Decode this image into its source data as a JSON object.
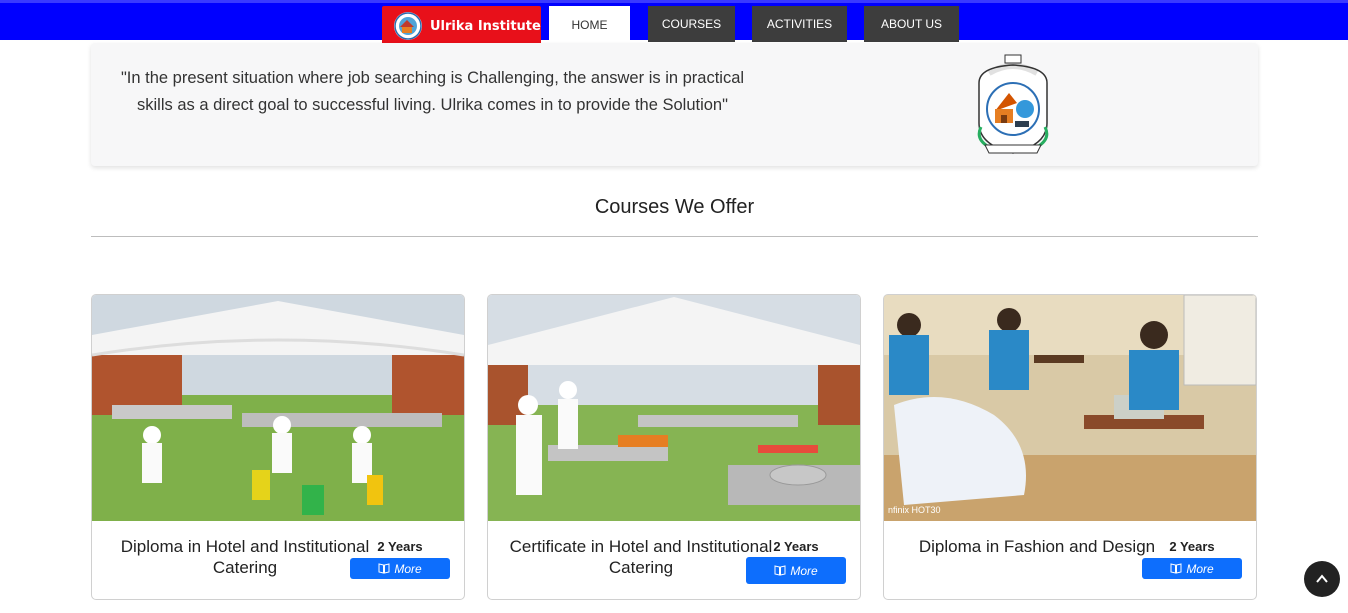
{
  "nav": {
    "brand": "Ulrika Institute",
    "items": [
      {
        "label": "HOME",
        "active": true
      },
      {
        "label": "COURSES",
        "active": false
      },
      {
        "label": "ACTIVITIES",
        "active": false
      },
      {
        "label": "ABOUT US",
        "active": false
      }
    ]
  },
  "hero": {
    "quote": "\"In the present situation where job searching is Challenging, the answer is in practical skills as a direct goal to successful living. Ulrika comes in to provide the Solution\""
  },
  "courses_section": {
    "title": "Courses We Offer",
    "cards": [
      {
        "title": "Diploma in Hotel and Institutional Catering",
        "duration": "2 Years",
        "button": "More"
      },
      {
        "title": "Certificate in Hotel and Institutional Catering",
        "duration": "2 Years",
        "button": "More"
      },
      {
        "title": "Diploma in Fashion and Design",
        "duration": "2 Years",
        "button": "More",
        "image_caption": "nfinix HOT30"
      }
    ]
  },
  "colors": {
    "navbar": "#0000ff",
    "brand": "#e8101a",
    "nav_item": "#3d3d3d",
    "button": "#0d6efd"
  },
  "icons": {
    "more_button": "book-open-icon",
    "scroll_top": "chevron-up-icon"
  }
}
